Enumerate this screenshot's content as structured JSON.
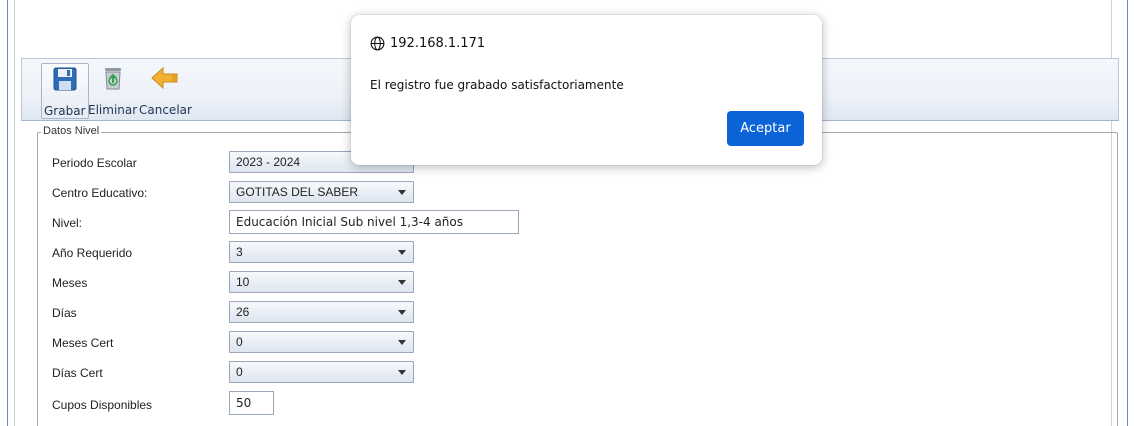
{
  "toolbar": {
    "save_label": "Grabar",
    "delete_label": "Eliminar",
    "cancel_label": "Cancelar",
    "icons": {
      "save": "floppy-disk-icon",
      "delete": "recycle-bin-icon",
      "cancel": "back-arrow-icon"
    }
  },
  "form": {
    "legend": "Datos  Nivel",
    "fields": [
      {
        "label": "Periodo Escolar",
        "value": "2023 - 2024",
        "type": "select"
      },
      {
        "label": "Centro Educativo:",
        "value": "GOTITAS DEL SABER",
        "type": "select"
      },
      {
        "label": "Nivel:",
        "value": "Educación Inicial Sub nivel 1,3-4 años",
        "type": "text"
      },
      {
        "label": "Año Requerido",
        "value": "3",
        "type": "select"
      },
      {
        "label": "Meses",
        "value": "10",
        "type": "select"
      },
      {
        "label": "Días",
        "value": "26",
        "type": "select"
      },
      {
        "label": "Meses Cert",
        "value": "0",
        "type": "select"
      },
      {
        "label": "Días Cert",
        "value": "0",
        "type": "select"
      },
      {
        "label": "Cupos Disponibles",
        "value": "50",
        "type": "text"
      }
    ]
  },
  "dialog": {
    "origin": "192.168.1.171",
    "message": "El registro fue grabado satisfactoriamente",
    "ok_label": "Aceptar"
  },
  "colors": {
    "accent_button": "#0b63d8",
    "toolbar_text": "#1f3553",
    "window_border": "#6c89b8"
  }
}
